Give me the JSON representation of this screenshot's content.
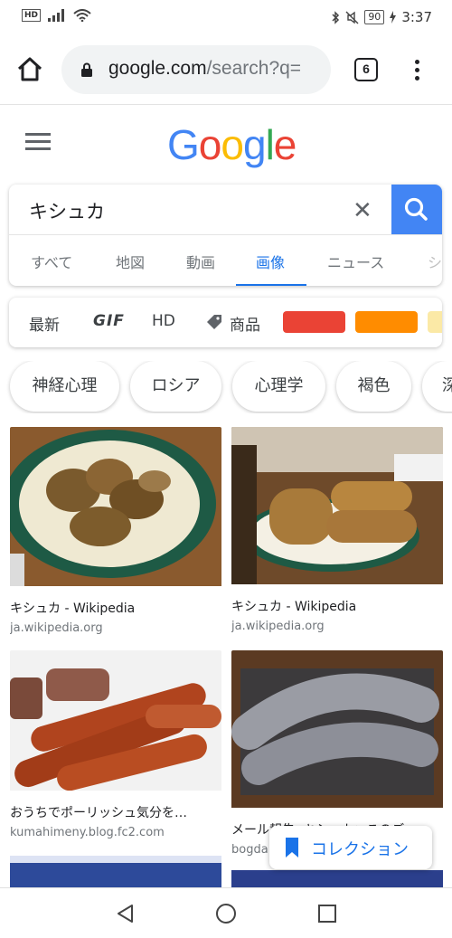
{
  "status_bar": {
    "network": "HD",
    "battery": "90",
    "time": "3:37"
  },
  "browser": {
    "url_domain": "google.com",
    "url_path": "/search?q=",
    "tab_count": "6"
  },
  "google": {
    "logo": [
      "G",
      "o",
      "o",
      "g",
      "l",
      "e"
    ],
    "logo_colors": [
      "#4285F4",
      "#EA4335",
      "#FBBC05",
      "#4285F4",
      "#34A853",
      "#EA4335"
    ]
  },
  "search": {
    "query": "キシュカ",
    "tabs": [
      {
        "label": "すべて"
      },
      {
        "label": "地図"
      },
      {
        "label": "動画"
      },
      {
        "label": "画像",
        "active": true
      },
      {
        "label": "ニュース"
      },
      {
        "label": "シ"
      }
    ]
  },
  "filters": {
    "recent": "最新",
    "gif": "GIF",
    "hd": "HD",
    "products": "商品",
    "color_swatches": [
      "#EA4335",
      "#FF8C00",
      "#FBE9A6"
    ]
  },
  "related_chips": [
    "神経心理",
    "ロシア",
    "心理学",
    "褐色",
    "深"
  ],
  "results": [
    {
      "title": "キシュカ - Wikipedia",
      "source": "ja.wikipedia.org"
    },
    {
      "title": "キシュカ - Wikipedia",
      "source": "ja.wikipedia.org"
    },
    {
      "title": "おうちでポーリッシュ気分を…",
      "source": "kumahimeny.blog.fc2.com"
    },
    {
      "title": "メール報告: キシュカ：このご…",
      "source": "bogda"
    }
  ],
  "collection_button": {
    "label": "コレクション"
  }
}
